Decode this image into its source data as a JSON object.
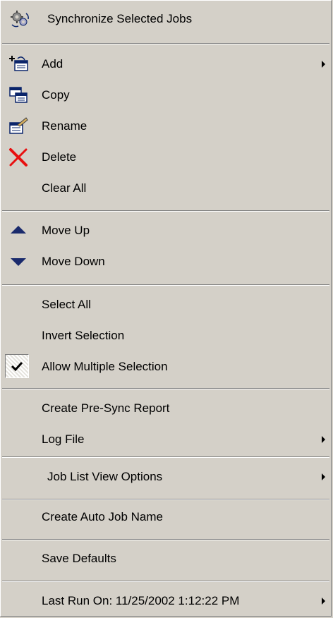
{
  "menu": {
    "sync_label": "Synchronize Selected Jobs",
    "add_label": "Add",
    "copy_label": "Copy",
    "rename_label": "Rename",
    "delete_label": "Delete",
    "clear_all_label": "Clear All",
    "move_up_label": "Move Up",
    "move_down_label": "Move Down",
    "select_all_label": "Select All",
    "invert_selection_label": "Invert Selection",
    "allow_multiple_label": "Allow Multiple Selection",
    "allow_multiple_checked": true,
    "pre_sync_report_label": "Create Pre-Sync Report",
    "log_file_label": "Log File",
    "job_list_view_options_label": "Job List View Options",
    "create_auto_job_name_label": "Create Auto Job Name",
    "save_defaults_label": "Save Defaults",
    "last_run_label": "Last Run On: 11/25/2002 1:12:22 PM"
  },
  "icons": {
    "sync": "sync-gears-icon",
    "add": "add-job-icon",
    "copy": "copy-icon",
    "rename": "rename-icon",
    "delete": "delete-x-icon",
    "move_up": "arrow-up-icon",
    "move_down": "arrow-down-icon",
    "check": "checkmark-icon",
    "submenu": "submenu-arrow-icon"
  },
  "colors": {
    "menu_bg": "#d4d0c8",
    "delete_red": "#e81010",
    "arrow_navy": "#1a2a6c",
    "icon_blue": "#0a246a"
  }
}
